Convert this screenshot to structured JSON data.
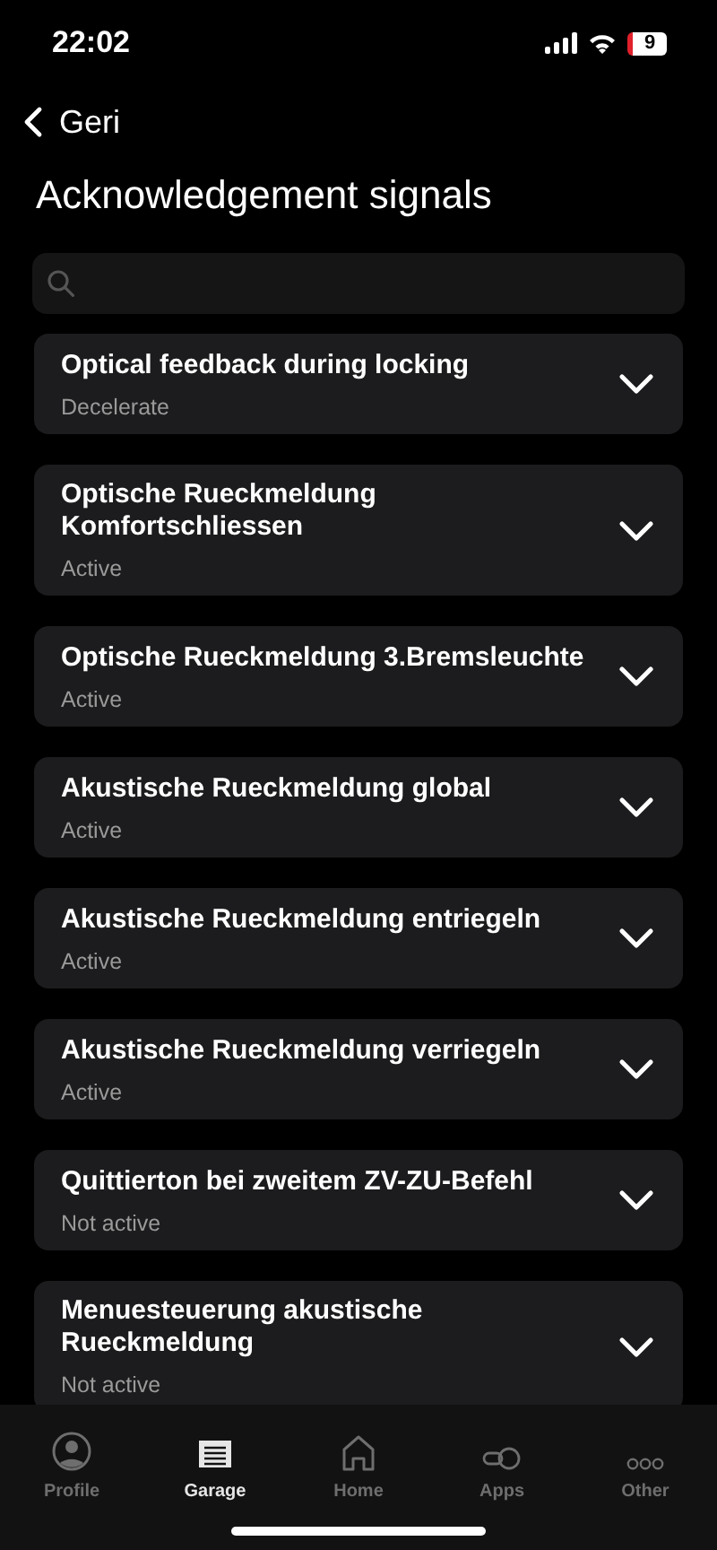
{
  "status_bar": {
    "time": "22:02",
    "battery": "9"
  },
  "nav": {
    "back_label": "Geri",
    "title": "Acknowledgement signals"
  },
  "settings": [
    {
      "title": "Optical feedback during locking",
      "value": "Decelerate",
      "expanded": false
    },
    {
      "title": "Optische Rueckmeldung Komfortschliessen",
      "value": "Active",
      "expanded": false
    },
    {
      "title": "Optische Rueckmeldung 3.Bremsleuchte",
      "value": "Active",
      "expanded": false
    },
    {
      "title": "Akustische Rueckmeldung global",
      "value": "Active",
      "expanded": false
    },
    {
      "title": "Akustische Rueckmeldung entriegeln",
      "value": "Active",
      "expanded": false
    },
    {
      "title": "Akustische Rueckmeldung verriegeln",
      "value": "Active",
      "expanded": false
    },
    {
      "title": "Quittierton bei zweitem ZV-ZU-Befehl",
      "value": "Not active",
      "expanded": false
    },
    {
      "title": "Menuesteuerung akustische Rueckmeldung",
      "value": "Not active",
      "expanded": false
    }
  ],
  "tab_bar": [
    {
      "kind": "profile",
      "label": "Profile",
      "selected": false
    },
    {
      "kind": "garage",
      "label": "Garage",
      "selected": true
    },
    {
      "kind": "home",
      "label": "Home",
      "selected": false
    },
    {
      "kind": "apps",
      "label": "Apps",
      "selected": false
    },
    {
      "kind": "other",
      "label": "Other",
      "selected": false
    }
  ]
}
